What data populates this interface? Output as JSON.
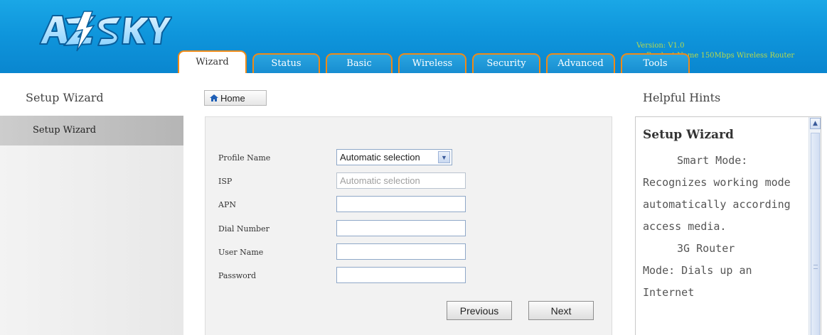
{
  "header": {
    "logo_text": "AZSKY",
    "version": "Version: V1.0",
    "product": "Product Name 150Mbps Wireless Router"
  },
  "tabs": [
    {
      "label": "Wizard",
      "active": true
    },
    {
      "label": "Status"
    },
    {
      "label": "Basic"
    },
    {
      "label": "Wireless"
    },
    {
      "label": "Security"
    },
    {
      "label": "Advanced"
    },
    {
      "label": "Tools"
    }
  ],
  "sidebar": {
    "title": "Setup Wizard",
    "items": [
      {
        "label": "Setup Wizard",
        "selected": true
      }
    ]
  },
  "home_label": "Home",
  "form": {
    "profile_label": "Profile Name",
    "profile_value": "Automatic selection",
    "isp_label": "ISP",
    "isp_placeholder": "Automatic selection",
    "apn_label": "APN",
    "dial_label": "Dial Number",
    "user_label": "User Name",
    "password_label": "Password",
    "previous_label": "Previous",
    "next_label": "Next"
  },
  "hints": {
    "title": "Helpful Hints",
    "heading": "Setup Wizard",
    "smart_mode_label": "Smart Mode:",
    "smart_mode_text": "Recognizes working mode automatically according access media.",
    "router_mode_label": "3G Router",
    "router_mode_text": "Mode: Dials up an Internet"
  },
  "colors": {
    "header_blue": "#0f96dc",
    "tab_border": "#f08a16"
  }
}
